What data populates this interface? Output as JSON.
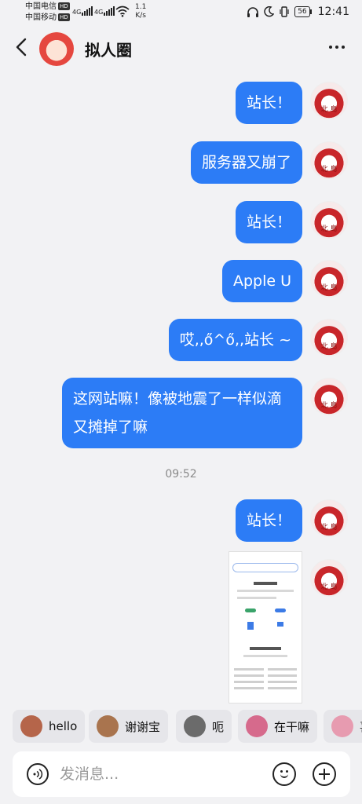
{
  "status_bar": {
    "carrier_1": "中国电信",
    "carrier_2": "中国移动",
    "hd_badge": "HD",
    "network_1": "4G",
    "network_2": "4G",
    "net_speed_value": "1.1",
    "net_speed_unit": "K/s",
    "battery": "56",
    "time": "12:41"
  },
  "header": {
    "title": "拟人圈"
  },
  "messages": [
    {
      "text": "站长！"
    },
    {
      "text": "服务器又崩了"
    },
    {
      "text": "站长！"
    },
    {
      "text": "Apple U"
    },
    {
      "text": "哎,,ő^ő,,站长 ~"
    },
    {
      "text": "这网站嘛！像被地震了一样似滴又摊掉了嘛"
    },
    {
      "text": "站长！"
    }
  ],
  "avatar_text": "北 島",
  "timestamp": "09:52",
  "quick_replies": [
    {
      "label": "hello",
      "color": "#b5654a"
    },
    {
      "label": "谢谢宝",
      "color": "#a9744e"
    },
    {
      "label": "呃",
      "color": "#6b6b6b"
    },
    {
      "label": "在干嘛",
      "color": "#d66a8c"
    },
    {
      "label": "喜",
      "color": "#e79bb0"
    }
  ],
  "input": {
    "placeholder": "发消息..."
  },
  "colors": {
    "bubble": "#2c7cf6",
    "background": "#f2f2f4"
  }
}
